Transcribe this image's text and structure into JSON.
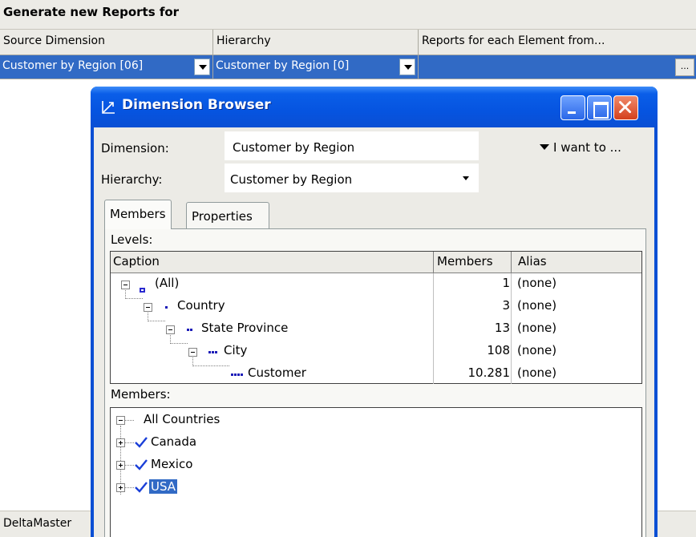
{
  "generate": {
    "title": "Generate new Reports for",
    "columns": [
      "Source Dimension",
      "Hierarchy",
      "Reports for each Element from..."
    ],
    "row": {
      "source_dimension": "Customer by Region [06]",
      "hierarchy": "Customer by Region [0]",
      "reports_for_each": "",
      "ellipsis": "..."
    }
  },
  "status": {
    "label": "DeltaMaster"
  },
  "window": {
    "title": "Dimension Browser",
    "icon": "axes-icon",
    "dimension_label": "Dimension:",
    "dimension_value": "Customer by Region",
    "hierarchy_label": "Hierarchy:",
    "hierarchy_value": "Customer by Region",
    "i_want_to": "I want to ...",
    "tabs": [
      "Members",
      "Properties"
    ],
    "levels_label": "Levels:",
    "levels_columns": [
      "Caption",
      "Members",
      "Alias"
    ],
    "levels": [
      {
        "caption": "(All)",
        "members": "1",
        "alias": "(none)"
      },
      {
        "caption": "Country",
        "members": "3",
        "alias": "(none)"
      },
      {
        "caption": "State Province",
        "members": "13",
        "alias": "(none)"
      },
      {
        "caption": "City",
        "members": "108",
        "alias": "(none)"
      },
      {
        "caption": "Customer",
        "members": "10.281",
        "alias": "(none)"
      }
    ],
    "members_label": "Members:",
    "members": {
      "root": "All Countries",
      "children": [
        "Canada",
        "Mexico",
        "USA"
      ]
    }
  },
  "colors": {
    "selection": "#316ac5",
    "titlebar": "#0654e0",
    "check": "#1a3fd8"
  }
}
